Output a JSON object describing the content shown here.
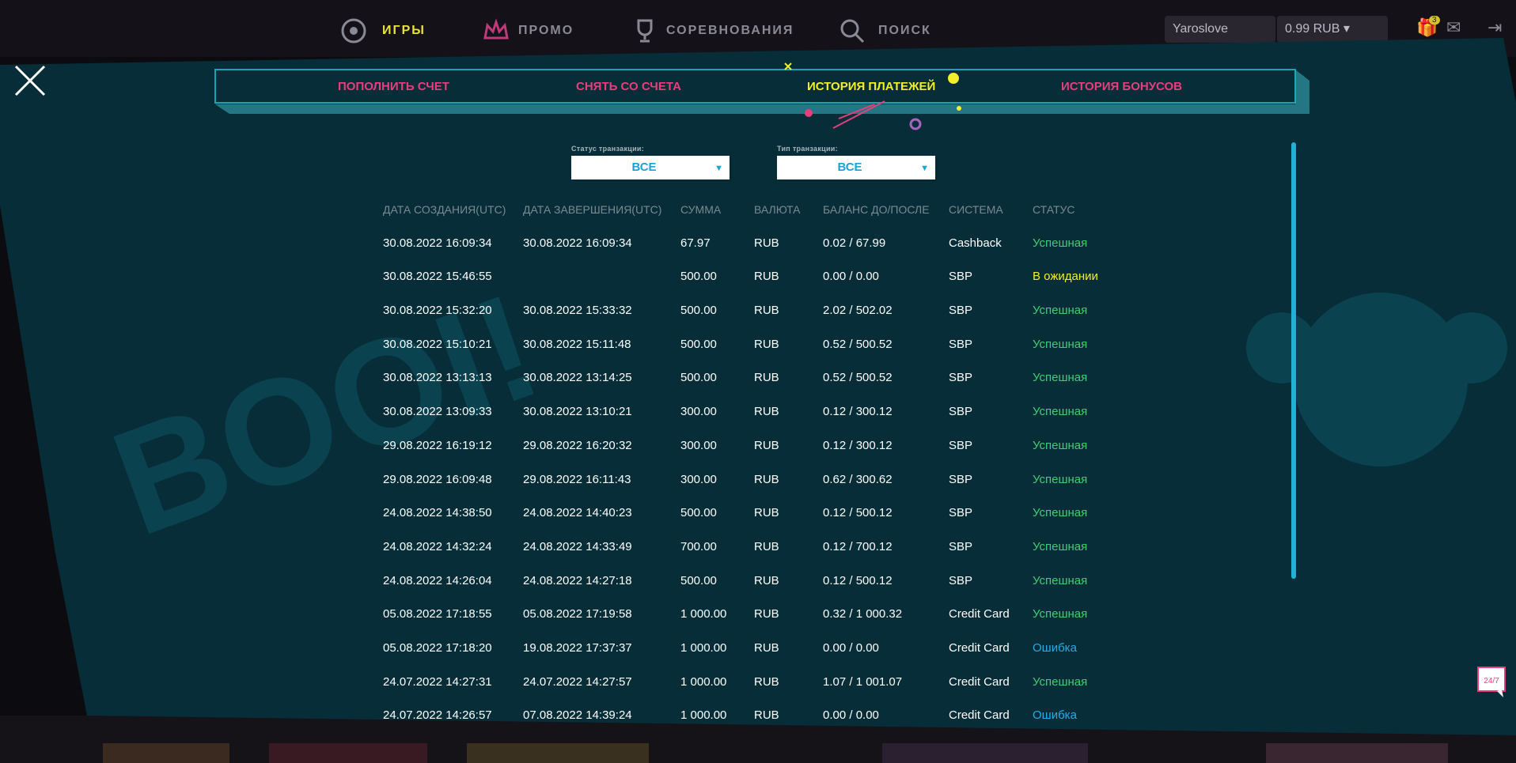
{
  "topnav": {
    "games": "ИГРЫ",
    "promo": "ПРОМО",
    "contests": "СОРЕВНОВАНИЯ",
    "search": "ПОИСК",
    "user": "Yaroslove",
    "balance": "0.99 RUB",
    "gift_count": "3"
  },
  "tabs": [
    {
      "label": "ПОПОЛНИТЬ СЧЕТ"
    },
    {
      "label": "СНЯТЬ СО СЧЕТА"
    },
    {
      "label": "ИСТОРИЯ ПЛАТЕЖЕЙ"
    },
    {
      "label": "ИСТОРИЯ БОНУСОВ"
    }
  ],
  "filters": {
    "status": {
      "label": "Статус транзакции:",
      "value": "ВСЕ"
    },
    "type": {
      "label": "Тип транзакции:",
      "value": "ВСЕ"
    }
  },
  "table": {
    "headers": [
      "ДАТА СОЗДАНИЯ(UTC)",
      "ДАТА ЗАВЕРШЕНИЯ(UTC)",
      "СУММА",
      "ВАЛЮТА",
      "БАЛАНС ДО/ПОСЛЕ",
      "СИСТЕМА",
      "СТАТУС"
    ],
    "rows": [
      {
        "created": "30.08.2022 16:09:34",
        "completed": "30.08.2022 16:09:34",
        "amount": "67.97",
        "currency": "RUB",
        "balance": "0.02 / 67.99",
        "system": "Cashback",
        "status": "Успешная",
        "kind": "ok"
      },
      {
        "created": "30.08.2022 15:46:55",
        "completed": "",
        "amount": "500.00",
        "currency": "RUB",
        "balance": "0.00 / 0.00",
        "system": "SBP",
        "status": "В ожидании",
        "kind": "wait"
      },
      {
        "created": "30.08.2022 15:32:20",
        "completed": "30.08.2022 15:33:32",
        "amount": "500.00",
        "currency": "RUB",
        "balance": "2.02 / 502.02",
        "system": "SBP",
        "status": "Успешная",
        "kind": "ok"
      },
      {
        "created": "30.08.2022 15:10:21",
        "completed": "30.08.2022 15:11:48",
        "amount": "500.00",
        "currency": "RUB",
        "balance": "0.52 / 500.52",
        "system": "SBP",
        "status": "Успешная",
        "kind": "ok"
      },
      {
        "created": "30.08.2022 13:13:13",
        "completed": "30.08.2022 13:14:25",
        "amount": "500.00",
        "currency": "RUB",
        "balance": "0.52 / 500.52",
        "system": "SBP",
        "status": "Успешная",
        "kind": "ok"
      },
      {
        "created": "30.08.2022 13:09:33",
        "completed": "30.08.2022 13:10:21",
        "amount": "300.00",
        "currency": "RUB",
        "balance": "0.12 / 300.12",
        "system": "SBP",
        "status": "Успешная",
        "kind": "ok"
      },
      {
        "created": "29.08.2022 16:19:12",
        "completed": "29.08.2022 16:20:32",
        "amount": "300.00",
        "currency": "RUB",
        "balance": "0.12 / 300.12",
        "system": "SBP",
        "status": "Успешная",
        "kind": "ok"
      },
      {
        "created": "29.08.2022 16:09:48",
        "completed": "29.08.2022 16:11:43",
        "amount": "300.00",
        "currency": "RUB",
        "balance": "0.62 / 300.62",
        "system": "SBP",
        "status": "Успешная",
        "kind": "ok"
      },
      {
        "created": "24.08.2022 14:38:50",
        "completed": "24.08.2022 14:40:23",
        "amount": "500.00",
        "currency": "RUB",
        "balance": "0.12 / 500.12",
        "system": "SBP",
        "status": "Успешная",
        "kind": "ok"
      },
      {
        "created": "24.08.2022 14:32:24",
        "completed": "24.08.2022 14:33:49",
        "amount": "700.00",
        "currency": "RUB",
        "balance": "0.12 / 700.12",
        "system": "SBP",
        "status": "Успешная",
        "kind": "ok"
      },
      {
        "created": "24.08.2022 14:26:04",
        "completed": "24.08.2022 14:27:18",
        "amount": "500.00",
        "currency": "RUB",
        "balance": "0.12 / 500.12",
        "system": "SBP",
        "status": "Успешная",
        "kind": "ok"
      },
      {
        "created": "05.08.2022 17:18:55",
        "completed": "05.08.2022 17:19:58",
        "amount": "1 000.00",
        "currency": "RUB",
        "balance": "0.32 / 1 000.32",
        "system": "Credit Card",
        "status": "Успешная",
        "kind": "ok"
      },
      {
        "created": "05.08.2022 17:18:20",
        "completed": "19.08.2022 17:37:37",
        "amount": "1 000.00",
        "currency": "RUB",
        "balance": "0.00 / 0.00",
        "system": "Credit Card",
        "status": "Ошибка",
        "kind": "err"
      },
      {
        "created": "24.07.2022 14:27:31",
        "completed": "24.07.2022 14:27:57",
        "amount": "1 000.00",
        "currency": "RUB",
        "balance": "1.07 / 1 001.07",
        "system": "Credit Card",
        "status": "Успешная",
        "kind": "ok"
      },
      {
        "created": "24.07.2022 14:26:57",
        "completed": "07.08.2022 14:39:24",
        "amount": "1 000.00",
        "currency": "RUB",
        "balance": "0.00 / 0.00",
        "system": "Credit Card",
        "status": "Ошибка",
        "kind": "err"
      }
    ]
  },
  "support": {
    "label": "24/7"
  }
}
